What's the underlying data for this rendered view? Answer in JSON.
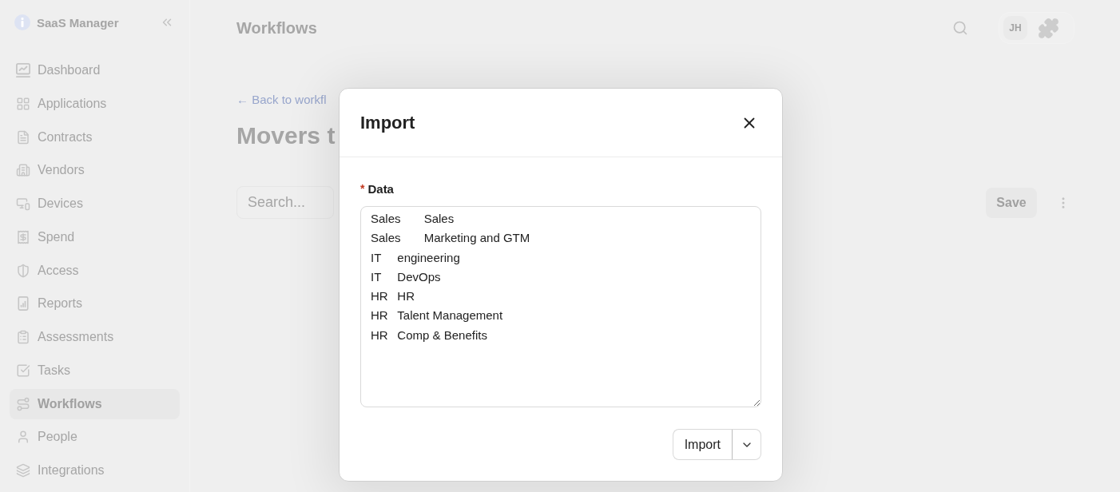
{
  "sidebar": {
    "app_name": "SaaS Manager",
    "items": [
      {
        "label": "Dashboard",
        "selected": false
      },
      {
        "label": "Applications",
        "selected": false
      },
      {
        "label": "Contracts",
        "selected": false
      },
      {
        "label": "Vendors",
        "selected": false
      },
      {
        "label": "Devices",
        "selected": false
      },
      {
        "label": "Spend",
        "selected": false
      },
      {
        "label": "Access",
        "selected": false
      },
      {
        "label": "Reports",
        "selected": false
      },
      {
        "label": "Assessments",
        "selected": false
      },
      {
        "label": "Tasks",
        "selected": false
      },
      {
        "label": "Workflows",
        "selected": true
      },
      {
        "label": "People",
        "selected": false
      },
      {
        "label": "Integrations",
        "selected": false
      }
    ]
  },
  "header": {
    "title": "Workflows",
    "avatar_initials": "JH"
  },
  "page": {
    "back_link": "← Back to workfl",
    "title": "Movers t",
    "search": {
      "placeholder": "Search..."
    },
    "save_button": "Save"
  },
  "modal": {
    "title": "Import",
    "field": {
      "required_mark": "*",
      "label": "Data",
      "value": "Sales\tSales\nSales\tMarketing and GTM\nIT\tengineering\nIT\tDevOps\nHR\tHR\nHR\tTalent Management\nHR\tComp & Benefits"
    },
    "submit_button": "Import"
  }
}
